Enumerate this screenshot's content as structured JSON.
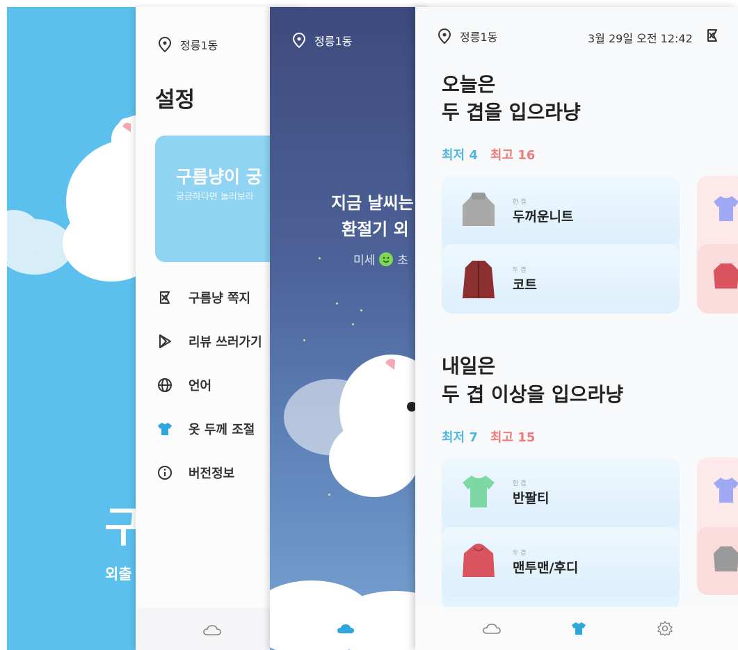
{
  "splash": {
    "title": "구",
    "subtitle": "외출"
  },
  "settings": {
    "location": "정릉1동",
    "title": "설정",
    "banner": {
      "title": "구름냥이 궁",
      "subtitle": "궁금하다면 눌러보라"
    },
    "menu": [
      {
        "label": "구름냥 쪽지",
        "icon": "note-icon"
      },
      {
        "label": "리뷰 쓰러가기",
        "icon": "play-store-icon"
      },
      {
        "label": "언어",
        "icon": "globe-icon"
      },
      {
        "label": "옷 두께 조절",
        "icon": "shirt-icon"
      },
      {
        "label": "버전정보",
        "icon": "info-icon"
      }
    ]
  },
  "weather": {
    "location": "정릉1동",
    "line1": "지금 날씨는",
    "line2": "환절기 외",
    "dust_label": "미세",
    "dust_label2": "초"
  },
  "clothes": {
    "location": "정릉1동",
    "datetime": "3월 29일 오전 12:42",
    "today": {
      "title_line1": "오늘은",
      "title_line2": "두 겹을 입으라냥",
      "min": "최저 4",
      "max": "최고 16",
      "items": [
        {
          "layer": "한 겹",
          "name": "두꺼운니트",
          "color": "#a9a9a9"
        },
        {
          "layer": "두 겹",
          "name": "코트",
          "color": "#8b2f2f"
        }
      ]
    },
    "tomorrow": {
      "title_line1": "내일은",
      "title_line2": "두 겹 이상을 입으라냥",
      "min": "최저 7",
      "max": "최고 15",
      "items": [
        {
          "layer": "한 겹",
          "name": "반팔티",
          "color": "#7ed8a4"
        },
        {
          "layer": "두 겹",
          "name": "맨투맨/후디",
          "color": "#d9545e"
        }
      ]
    }
  },
  "colors": {
    "splash_bg": "#5bc0ee",
    "accent_blue": "#4fb6dd",
    "accent_red": "#ef7b7b",
    "nav_active": "#2fa7de"
  }
}
